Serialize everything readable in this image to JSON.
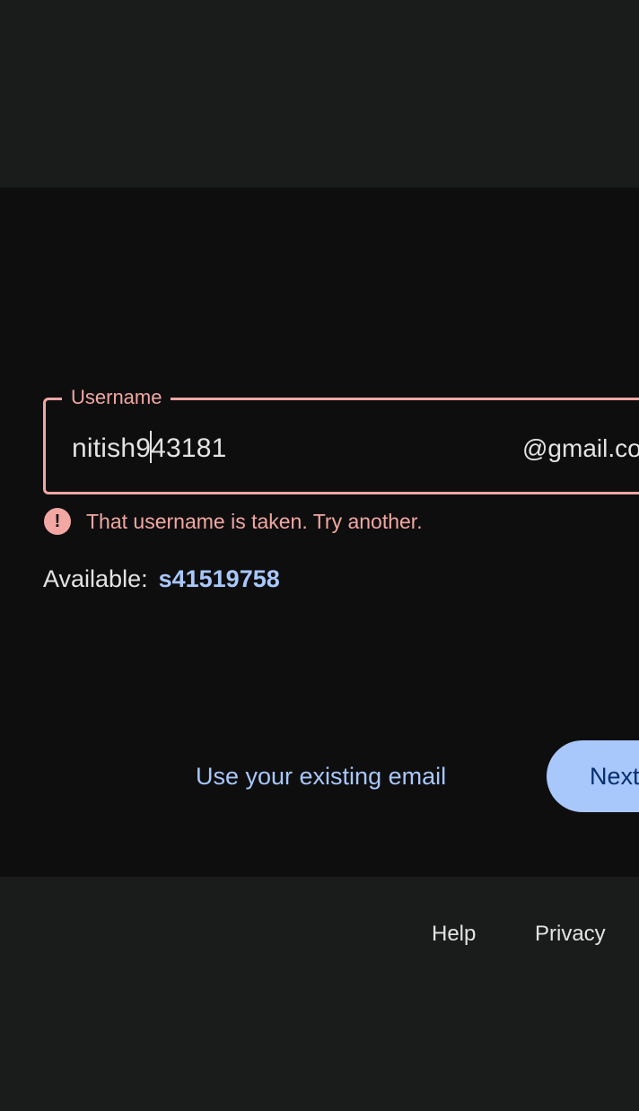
{
  "username_field": {
    "label": "Username",
    "value_before_caret": "nitish9",
    "value_after_caret": "43181",
    "suffix": "@gmail.com"
  },
  "error": {
    "icon": "error-icon",
    "message": "That username is taken. Try another."
  },
  "suggestion": {
    "label": "Available:",
    "value": "s41519758"
  },
  "actions": {
    "existing_email_label": "Use your existing email",
    "next_label": "Next"
  },
  "footer": {
    "help_label": "Help",
    "privacy_label": "Privacy"
  },
  "colors": {
    "error": "#f2a7a2",
    "accent": "#a8c7fa",
    "background": "#0e0e0f",
    "outer_background": "#1a1b1b"
  }
}
